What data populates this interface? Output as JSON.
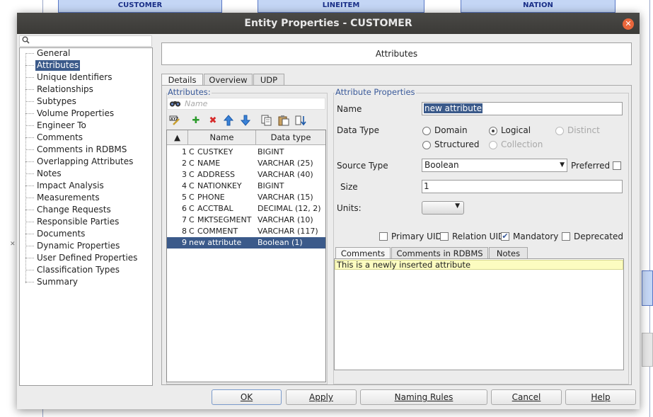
{
  "background": {
    "entities": [
      "CUSTOMER",
      "LINEITEM",
      "NATION"
    ],
    "close_glyph": "✕"
  },
  "dialog": {
    "title": "Entity Properties - CUSTOMER",
    "close_glyph": "✕"
  },
  "nav": {
    "search_icon": "search-icon",
    "items": [
      "General",
      "Attributes",
      "Unique Identifiers",
      "Relationships",
      "Subtypes",
      "Volume Properties",
      "Engineer To",
      "Comments",
      "Comments in RDBMS",
      "Overlapping Attributes",
      "Notes",
      "Impact Analysis",
      "Measurements",
      "Change Requests",
      "Responsible Parties",
      "Documents",
      "Dynamic Properties",
      "User Defined Properties",
      "Classification Types",
      "Summary"
    ],
    "selected_index": 1
  },
  "header": {
    "title": "Attributes"
  },
  "tabs": [
    "Details",
    "Overview",
    "UDP"
  ],
  "attributes_panel": {
    "group_label": "Attributes:",
    "filter_placeholder": "Name",
    "columns": [
      "Name",
      "Data type"
    ],
    "rows": [
      {
        "num": "1",
        "kind": "C",
        "name": "CUSTKEY",
        "type": "BIGINT"
      },
      {
        "num": "2",
        "kind": "C",
        "name": "NAME",
        "type": "VARCHAR (25)"
      },
      {
        "num": "3",
        "kind": "C",
        "name": "ADDRESS",
        "type": "VARCHAR (40)"
      },
      {
        "num": "4",
        "kind": "C",
        "name": "NATIONKEY",
        "type": "BIGINT"
      },
      {
        "num": "5",
        "kind": "C",
        "name": "PHONE",
        "type": "VARCHAR (15)"
      },
      {
        "num": "6",
        "kind": "C",
        "name": "ACCTBAL",
        "type": "DECIMAL (12, 2)"
      },
      {
        "num": "7",
        "kind": "C",
        "name": "MKTSEGMENT",
        "type": "VARCHAR (10)"
      },
      {
        "num": "8",
        "kind": "C",
        "name": "COMMENT",
        "type": "VARCHAR (117)"
      },
      {
        "num": "9",
        "kind": "",
        "name": "new attribute",
        "type": "Boolean (1)"
      }
    ],
    "selected_row": 8
  },
  "properties": {
    "group_label": "Attribute Properties",
    "name_label": "Name",
    "name_value": "new attribute",
    "datatype_label": "Data Type",
    "datatype_options": {
      "domain": "Domain",
      "logical": "Logical",
      "distinct": "Distinct",
      "structured": "Structured",
      "collection": "Collection"
    },
    "datatype_selected": "Logical",
    "source_type_label": "Source Type",
    "source_type_value": "Boolean",
    "preferred_label": "Preferred",
    "size_label": "Size",
    "size_value": "1",
    "units_label": "Units:",
    "units_value": "",
    "checks": {
      "primary_uid": "Primary UID",
      "relation_uid": "Relation UID",
      "mandatory": "Mandatory",
      "deprecated": "Deprecated"
    },
    "mandatory_checked": true,
    "comment_tabs": [
      "Comments",
      "Comments in RDBMS",
      "Notes"
    ],
    "comment_text": "This is a newly inserted attribute"
  },
  "buttons": {
    "ok": "OK",
    "apply": "Apply",
    "naming_rules": "Naming Rules",
    "cancel": "Cancel",
    "help": "Help"
  },
  "colors": {
    "selection": "#3b5a8a",
    "titlebar": "#3e3d3a",
    "close": "#e9663b",
    "comment_highlight": "#fcfcc0",
    "group_label": "#3a5a9a"
  }
}
